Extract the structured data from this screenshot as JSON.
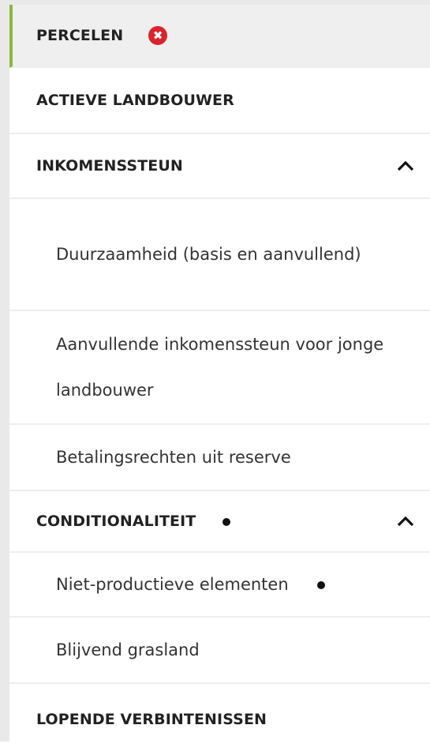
{
  "nav": {
    "percelen": {
      "label": "PERCELEN"
    },
    "actieve_landbouwer": {
      "label": "ACTIEVE LANDBOUWER"
    },
    "inkomenssteun": {
      "label": "INKOMENSSTEUN",
      "items": [
        "Duurzaamheid (basis en aanvullend)",
        "Aanvullende inkomenssteun voor jonge landbouwer",
        "Betalingsrechten uit reserve"
      ]
    },
    "conditionaliteit": {
      "label": "CONDITIONALITEIT",
      "items": [
        "Niet-productieve elementen",
        "Blijvend grasland"
      ]
    },
    "lopende_verbintenissen": {
      "label": "LOPENDE VERBINTENISSEN"
    }
  },
  "colors": {
    "active_indicator": "#8db63c",
    "error_badge": "#d9232e"
  },
  "icons": {
    "close": "close-icon",
    "chevron": "chevron-up-icon",
    "status": "status-dot-icon"
  }
}
